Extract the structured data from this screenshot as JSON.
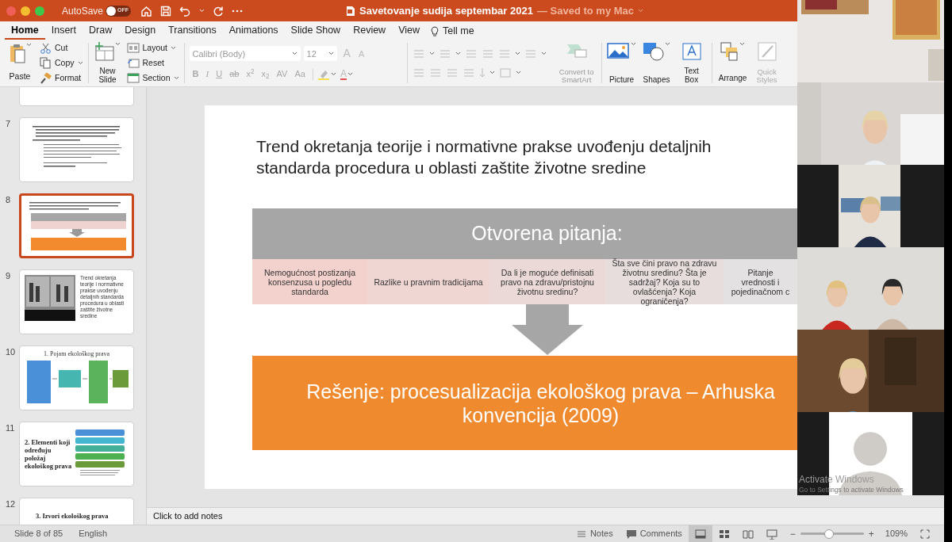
{
  "window": {
    "title": "Savetovanje sudija septembar 2021",
    "save_status": "— Saved to my Mac"
  },
  "quick_access": {
    "autosave_label": "AutoSave",
    "autosave_toggle": "OFF",
    "autosave_on": false
  },
  "ribbon_tabs": [
    {
      "label": "Home",
      "selected": true
    },
    {
      "label": "Insert",
      "selected": false
    },
    {
      "label": "Draw",
      "selected": false
    },
    {
      "label": "Design",
      "selected": false
    },
    {
      "label": "Transitions",
      "selected": false
    },
    {
      "label": "Animations",
      "selected": false
    },
    {
      "label": "Slide Show",
      "selected": false
    },
    {
      "label": "Review",
      "selected": false
    },
    {
      "label": "View",
      "selected": false
    }
  ],
  "tell_me": "Tell me",
  "clipboard": {
    "paste": "Paste",
    "cut": "Cut",
    "copy": "Copy",
    "format": "Format"
  },
  "slides_group": {
    "new_slide": "New Slide",
    "layout": "Layout",
    "reset": "Reset",
    "section": "Section"
  },
  "font": {
    "family": "Calibri (Body)",
    "size": "12",
    "grow": "A",
    "shrink": "A",
    "styles": [
      "B",
      "I",
      "U",
      "ab",
      "x$^{2}$",
      "x$_{2}$",
      "AV",
      "Aa"
    ],
    "color_button": "A"
  },
  "smartart": "Convert to SmartArt",
  "insert_group": [
    {
      "label": "Picture",
      "kind": "picture"
    },
    {
      "label": "Shapes",
      "kind": "shapes"
    },
    {
      "label": "Text Box",
      "kind": "textbox"
    }
  ],
  "arrange": "Arrange",
  "quick_styles": "Quick Styles",
  "slides": [
    {
      "kind": "blank",
      "selected": false
    },
    {
      "number": "7",
      "kind": "text",
      "selected": false
    },
    {
      "number": "8",
      "kind": "diagram",
      "selected": true
    },
    {
      "number": "9",
      "kind": "photo_text",
      "text": "Trend okretanja teorije i normativne prakse uvođenju detaljnih standarda procedura u oblasti zaštite životne sredine",
      "selected": false
    },
    {
      "number": "10",
      "kind": "boxes",
      "title": "1. Pojam ekološkog prava",
      "selected": false
    },
    {
      "number": "11",
      "kind": "list",
      "title": "2. Elementi koji određuju položaj ekološkog prava",
      "selected": false
    },
    {
      "number": "12",
      "kind": "title",
      "title": "3. Izvori ekološkog prava",
      "selected": false
    }
  ],
  "slide": {
    "title": "Trend okretanja teorije i normativne prakse uvođenju detaljnih standarda procedura u oblasti zaštite životne sredine",
    "band": "Otvorena pitanja:",
    "questions": [
      {
        "text": "Nemogućnost postizanja konsenzusa u pogledu standarda",
        "color": "#f3d1cd"
      },
      {
        "text": "Razlike u pravnim tradicijama",
        "color": "#efd6d3"
      },
      {
        "text": "Da li je moguće definisati pravo na zdravu/pristojnu životnu sredinu?",
        "color": "#ead9d7"
      },
      {
        "text": "Šta sve čini pravo na zdravu životnu sredinu? Šta je sadržaj? Koja su to ovlašćenja? Koja ograničenja?",
        "color": "#e6dddc"
      },
      {
        "text": "Pitanje vrednosti i pojedinačnom c",
        "color": "#e3e1e1"
      }
    ],
    "solution": "Rešenje: procesualizacija ekološkog prava – Arhuska konvencija (2009)"
  },
  "notes_placeholder": "Click to add notes",
  "status_bar": {
    "slide": "Slide 8 of 85",
    "language": "English",
    "notes": "Notes",
    "comments": "Comments",
    "views": [
      {
        "kind": "normal",
        "selected": true
      },
      {
        "kind": "sorter",
        "selected": false
      },
      {
        "kind": "reading",
        "selected": false
      },
      {
        "kind": "slideshow",
        "selected": false
      }
    ],
    "zoom": {
      "minus": "−",
      "plus": "+",
      "level": 0.45,
      "reading": "109%"
    }
  },
  "participants": [
    {
      "kind": "picture"
    },
    {
      "kind": "picture"
    },
    {
      "kind": "narrow_picture"
    },
    {
      "kind": "picture"
    },
    {
      "kind": "picture"
    },
    {
      "kind": "avatar"
    }
  ],
  "os_notice": {
    "title": "Activate Windows",
    "detail": "Go to Settings to activate Windows"
  }
}
